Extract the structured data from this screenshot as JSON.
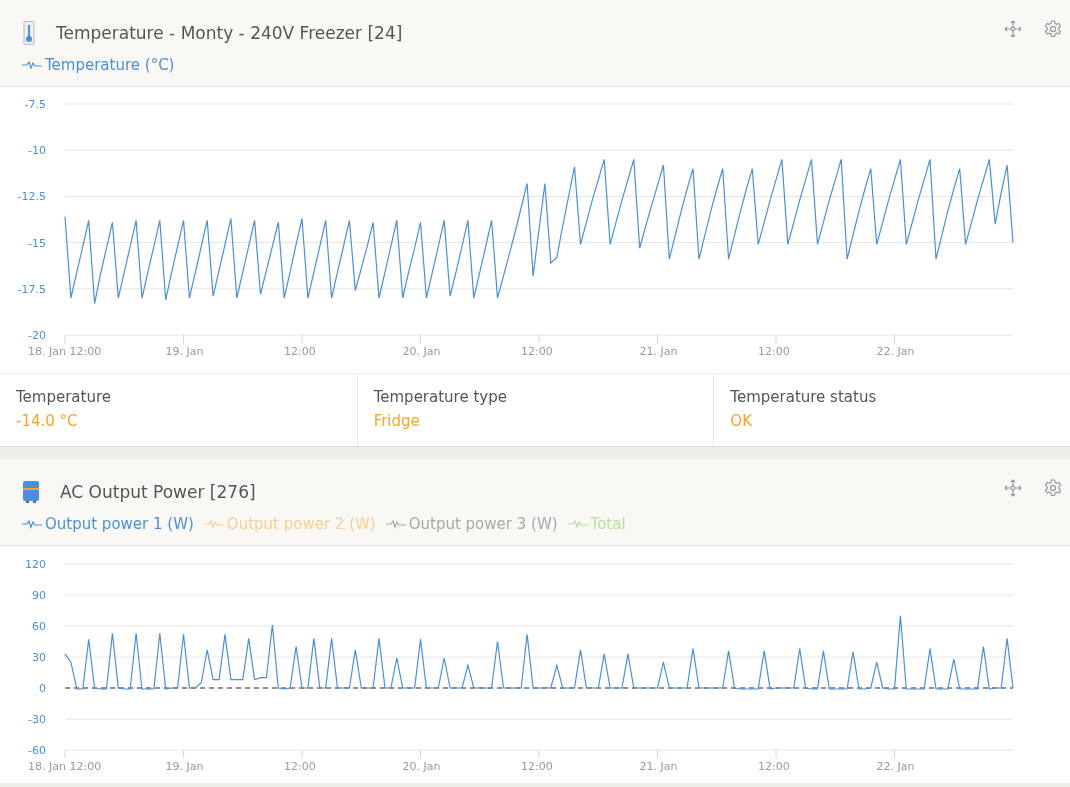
{
  "panels": [
    {
      "kind": "chart",
      "title": "Temperature - Monty - 240V Freezer [24]",
      "legend": [
        {
          "label": "Temperature (°C)",
          "color": "#4a90d9"
        }
      ],
      "chart_data": {
        "type": "line",
        "grid": true,
        "ylim": [
          -20,
          -7.5
        ],
        "categories": [
          "18. Jan 12:00",
          null,
          null,
          null,
          null,
          null,
          null,
          null,
          null,
          null,
          null,
          null,
          null,
          null,
          null,
          null,
          null,
          null,
          null,
          null,
          "19. Jan",
          null,
          null,
          null,
          null,
          null,
          null,
          null,
          null,
          null,
          null,
          null,
          null,
          null,
          null,
          null,
          null,
          null,
          null,
          null,
          "12:00",
          null,
          null,
          null,
          null,
          null,
          null,
          null,
          null,
          null,
          null,
          null,
          null,
          null,
          null,
          null,
          null,
          null,
          null,
          null,
          "20. Jan",
          null,
          null,
          null,
          null,
          null,
          null,
          null,
          null,
          null,
          null,
          null,
          null,
          null,
          null,
          null,
          null,
          null,
          null,
          null,
          "12:00",
          null,
          null,
          null,
          null,
          null,
          null,
          null,
          null,
          null,
          null,
          null,
          null,
          null,
          null,
          null,
          null,
          null,
          null,
          null,
          "21. Jan",
          null,
          null,
          null,
          null,
          null,
          null,
          null,
          null,
          null,
          null,
          null,
          null,
          null,
          null,
          null,
          null,
          null,
          null,
          null,
          "12:00",
          null,
          null,
          null,
          null,
          null,
          null,
          null,
          null,
          null,
          null,
          null,
          null,
          null,
          null,
          null,
          null,
          null,
          null,
          null,
          "22. Jan",
          null,
          null,
          null,
          null,
          null,
          null,
          null,
          null,
          null,
          null,
          null,
          null,
          null,
          null,
          null,
          null,
          null,
          null,
          null,
          null
        ],
        "yticks": [
          {
            "value": -20,
            "label": "-20"
          },
          {
            "value": -17.5,
            "label": "-17.5"
          },
          {
            "value": -15,
            "label": "-15"
          },
          {
            "value": -12.5,
            "label": "-12.5"
          },
          {
            "value": -10,
            "label": "-10"
          },
          {
            "value": -7.5,
            "label": "-7.5"
          }
        ],
        "series": [
          {
            "color": "#4a90d9",
            "values": [
              -13.6,
              -18,
              -16.6,
              -15.2,
              -13.8,
              -18.3,
              -16.7,
              -15.3,
              -13.9,
              -18,
              -16.6,
              -15.2,
              -13.8,
              -18,
              -16.6,
              -15.2,
              -13.8,
              -18.1,
              -16.6,
              -15.2,
              -13.8,
              -18,
              -16.6,
              -15.2,
              -13.8,
              -17.9,
              -16.5,
              -15.1,
              -13.7,
              -18,
              -16.6,
              -15.2,
              -13.8,
              -17.8,
              -16.5,
              -15.2,
              -13.9,
              -18,
              -16.6,
              -15.1,
              -13.7,
              -18,
              -16.6,
              -15.2,
              -13.8,
              -18,
              -16.6,
              -15.2,
              -13.8,
              -17.6,
              -16.4,
              -15.2,
              -13.9,
              -18,
              -16.6,
              -15.2,
              -13.8,
              -18,
              -16.6,
              -15.3,
              -13.9,
              -18,
              -16.6,
              -15.2,
              -13.8,
              -17.9,
              -16.6,
              -15.2,
              -13.8,
              -18,
              -16.6,
              -15.2,
              -13.8,
              -18,
              -16.8,
              -15.6,
              -14.4,
              -13.1,
              -11.8,
              -16.8,
              -14.3,
              -11.8,
              -16.1,
              -15.8,
              -14.1,
              -12.5,
              -10.9,
              -15.1,
              -13.9,
              -12.7,
              -11.6,
              -10.5,
              -15.1,
              -13.9,
              -12.7,
              -11.6,
              -10.5,
              -15.3,
              -14.1,
              -13,
              -11.9,
              -10.8,
              -15.9,
              -14.6,
              -13.3,
              -12.1,
              -11,
              -15.9,
              -14.6,
              -13.3,
              -12.1,
              -11,
              -15.9,
              -14.6,
              -13.3,
              -12.1,
              -11,
              -15.1,
              -13.9,
              -12.7,
              -11.6,
              -10.5,
              -15.1,
              -13.9,
              -12.7,
              -11.6,
              -10.5,
              -15.1,
              -13.9,
              -12.7,
              -11.6,
              -10.5,
              -15.9,
              -14.6,
              -13.3,
              -12.1,
              -11,
              -15.1,
              -13.9,
              -12.7,
              -11.6,
              -10.5,
              -15.1,
              -13.9,
              -12.7,
              -11.6,
              -10.5,
              -15.9,
              -14.6,
              -13.3,
              -12.1,
              -11,
              -15.1,
              -13.9,
              -12.7,
              -11.6,
              -10.5,
              -14,
              -12.3,
              -10.8,
              -15
            ]
          }
        ]
      },
      "stats": [
        {
          "label": "Temperature",
          "value": "-14.0 °C"
        },
        {
          "label": "Temperature type",
          "value": "Fridge"
        },
        {
          "label": "Temperature status",
          "value": "OK"
        }
      ]
    },
    {
      "kind": "chart",
      "title": "AC Output Power [276]",
      "legend": [
        {
          "label": "Output power 1 (W)",
          "color": "#4a90d9"
        },
        {
          "label": "Output power 2 (W)",
          "color": "#f8cf8f"
        },
        {
          "label": "Output power 3 (W)",
          "color": "#a8a8a8"
        },
        {
          "label": "Total",
          "color": "#b5dfa0"
        }
      ],
      "chart_data": {
        "type": "line",
        "grid": true,
        "ref_lines": [
          {
            "axis": "y",
            "value": 0
          }
        ],
        "ylim": [
          -60,
          120
        ],
        "categories": [
          "18. Jan 12:00",
          null,
          null,
          null,
          null,
          null,
          null,
          null,
          null,
          null,
          null,
          null,
          null,
          null,
          null,
          null,
          null,
          null,
          null,
          null,
          "19. Jan",
          null,
          null,
          null,
          null,
          null,
          null,
          null,
          null,
          null,
          null,
          null,
          null,
          null,
          null,
          null,
          null,
          null,
          null,
          null,
          "12:00",
          null,
          null,
          null,
          null,
          null,
          null,
          null,
          null,
          null,
          null,
          null,
          null,
          null,
          null,
          null,
          null,
          null,
          null,
          null,
          "20. Jan",
          null,
          null,
          null,
          null,
          null,
          null,
          null,
          null,
          null,
          null,
          null,
          null,
          null,
          null,
          null,
          null,
          null,
          null,
          null,
          "12:00",
          null,
          null,
          null,
          null,
          null,
          null,
          null,
          null,
          null,
          null,
          null,
          null,
          null,
          null,
          null,
          null,
          null,
          null,
          null,
          "21. Jan",
          null,
          null,
          null,
          null,
          null,
          null,
          null,
          null,
          null,
          null,
          null,
          null,
          null,
          null,
          null,
          null,
          null,
          null,
          null,
          "12:00",
          null,
          null,
          null,
          null,
          null,
          null,
          null,
          null,
          null,
          null,
          null,
          null,
          null,
          null,
          null,
          null,
          null,
          null,
          null,
          "22. Jan",
          null,
          null,
          null,
          null,
          null,
          null,
          null,
          null,
          null,
          null,
          null,
          null,
          null,
          null,
          null,
          null,
          null,
          null,
          null,
          null
        ],
        "yticks": [
          {
            "value": -60,
            "label": "-60"
          },
          {
            "value": -30,
            "label": "-30"
          },
          {
            "value": 0,
            "label": "0"
          },
          {
            "value": 30,
            "label": "30"
          },
          {
            "value": 60,
            "label": "60"
          },
          {
            "value": 90,
            "label": "90"
          },
          {
            "value": 120,
            "label": "120"
          }
        ],
        "series": [
          {
            "color": "#4a90d9",
            "values": [
              33,
              25,
              -1,
              -1,
              47,
              0,
              -1,
              -1,
              53,
              0,
              -1,
              -1,
              53,
              -1,
              -1,
              -1,
              53,
              -1,
              0,
              0,
              52,
              0,
              0,
              5,
              37,
              8,
              8,
              52,
              8,
              8,
              8,
              48,
              8,
              10,
              10,
              61,
              0,
              -1,
              0,
              40,
              0,
              0,
              48,
              0,
              0,
              48,
              0,
              0,
              0,
              37,
              0,
              0,
              0,
              48,
              0,
              0,
              29,
              0,
              0,
              0,
              47,
              0,
              0,
              0,
              29,
              0,
              0,
              0,
              22,
              0,
              0,
              0,
              0,
              45,
              0,
              0,
              0,
              0,
              52,
              0,
              0,
              0,
              0,
              22,
              0,
              0,
              0,
              37,
              0,
              0,
              0,
              33,
              0,
              0,
              0,
              33,
              0,
              0,
              0,
              0,
              0,
              25,
              0,
              0,
              0,
              0,
              38,
              0,
              0,
              0,
              0,
              0,
              36,
              0,
              -1,
              -1,
              -1,
              -1,
              36,
              -1,
              0,
              0,
              0,
              0,
              38,
              0,
              -1,
              -1,
              36,
              -1,
              -1,
              -1,
              -1,
              35,
              -1,
              -1,
              0,
              25,
              0,
              -1,
              -1,
              70,
              -1,
              -1,
              -1,
              -1,
              38,
              -1,
              -1,
              -1,
              28,
              -1,
              -1,
              -1,
              -1,
              40,
              -1,
              0,
              0,
              48,
              0
            ]
          }
        ]
      }
    }
  ]
}
